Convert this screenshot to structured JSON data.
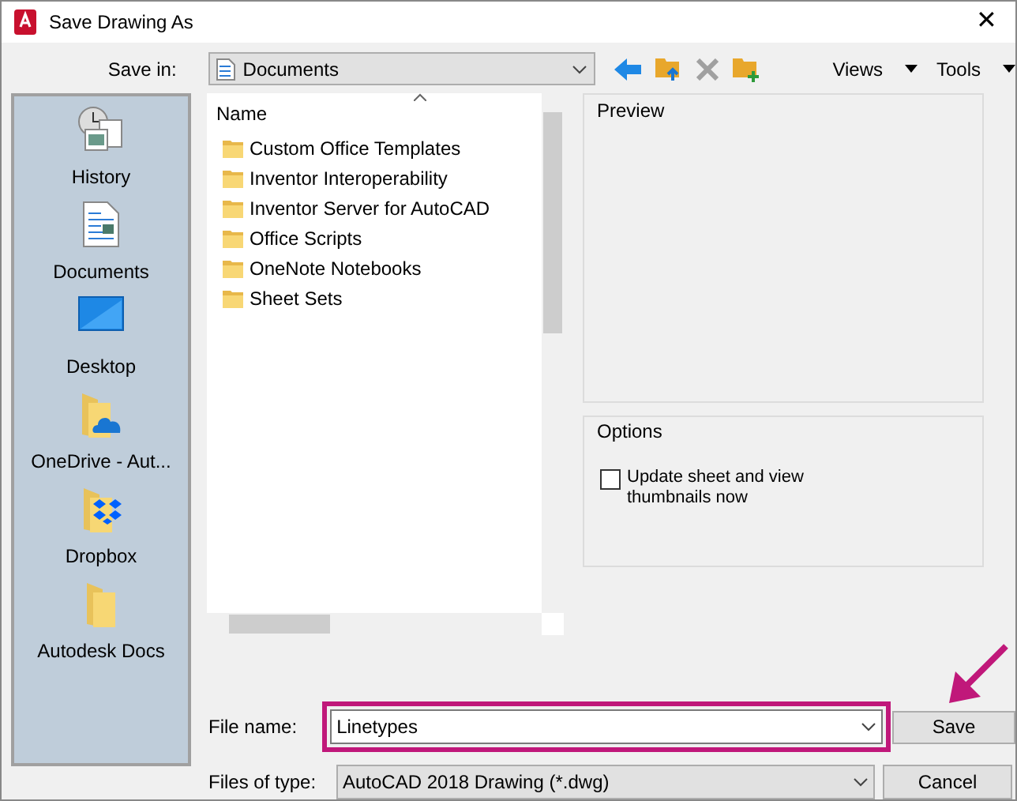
{
  "window": {
    "title": "Save Drawing As",
    "close": "✕"
  },
  "toolbar": {
    "save_in_label": "Save in:",
    "location": "Documents",
    "views": "Views",
    "tools": "Tools"
  },
  "places": [
    {
      "label": "History",
      "kind": "history"
    },
    {
      "label": "Documents",
      "kind": "documents"
    },
    {
      "label": "Desktop",
      "kind": "desktop"
    },
    {
      "label": "OneDrive - Aut...",
      "kind": "onedrive"
    },
    {
      "label": "Dropbox",
      "kind": "dropbox"
    },
    {
      "label": "Autodesk Docs",
      "kind": "folder"
    }
  ],
  "file_list": {
    "column": "Name",
    "items": [
      "Custom Office Templates",
      "Inventor Interoperability",
      "Inventor Server for AutoCAD",
      "Office Scripts",
      "OneNote Notebooks",
      "Sheet Sets"
    ]
  },
  "preview": {
    "title": "Preview"
  },
  "options": {
    "title": "Options",
    "checkbox": {
      "label": "Update sheet and view thumbnails now",
      "checked": false
    }
  },
  "file_name": {
    "label": "File name:",
    "value": "Linetypes"
  },
  "file_type": {
    "label": "Files of type:",
    "value": "AutoCAD 2018 Drawing (*.dwg)"
  },
  "buttons": [
    "Save",
    "Cancel"
  ]
}
